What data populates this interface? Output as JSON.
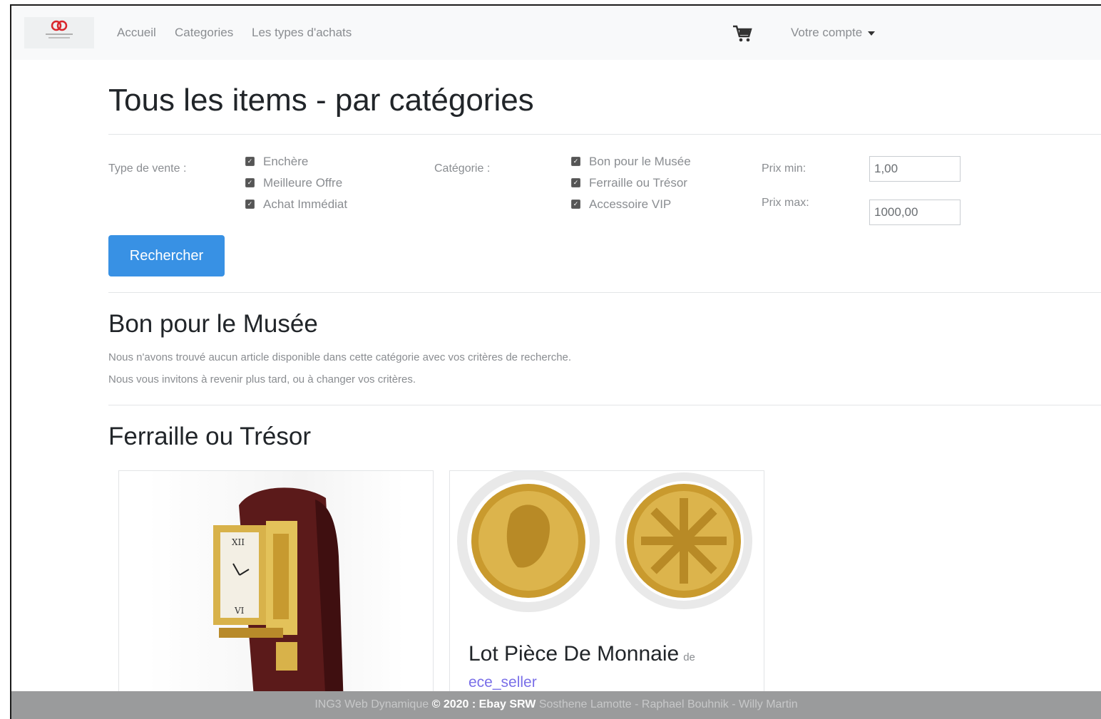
{
  "nav": {
    "links": [
      "Accueil",
      "Categories",
      "Les types d'achats"
    ],
    "account": "Votre compte"
  },
  "page_title": "Tous les items - par catégories",
  "filters": {
    "type_label": "Type de vente :",
    "types": [
      "Enchère",
      "Meilleure Offre",
      "Achat Immédiat"
    ],
    "category_label": "Catégorie :",
    "categories": [
      "Bon pour le Musée",
      "Ferraille ou Trésor",
      "Accessoire VIP"
    ],
    "price_min_label": "Prix min:",
    "price_min_value": "1,00",
    "price_max_label": "Prix max:",
    "price_max_value": "1000,00",
    "search_label": "Rechercher"
  },
  "sections": [
    {
      "title": "Bon pour le Musée",
      "messages": [
        "Nous n'avons trouvé aucun article disponible dans cette catégorie avec vos critères de recherche.",
        "Nous vous invitons à revenir plus tard, ou à changer vos critères."
      ]
    },
    {
      "title": "Ferraille ou Trésor",
      "items": [
        {
          "title": "",
          "seller": ""
        },
        {
          "title": "Lot Pièce De Monnaie",
          "by": "de",
          "seller": "ece_seller"
        }
      ]
    }
  ],
  "footer": {
    "prefix": "ING3 Web Dynamique",
    "brand": "© 2020 : Ebay SRW",
    "authors": "Sosthene Lamotte - Raphael Bouhnik - Willy Martin"
  },
  "colors": {
    "primary": "#3891e4",
    "link": "#7a6fe8",
    "footer": "#9a9b9c"
  }
}
